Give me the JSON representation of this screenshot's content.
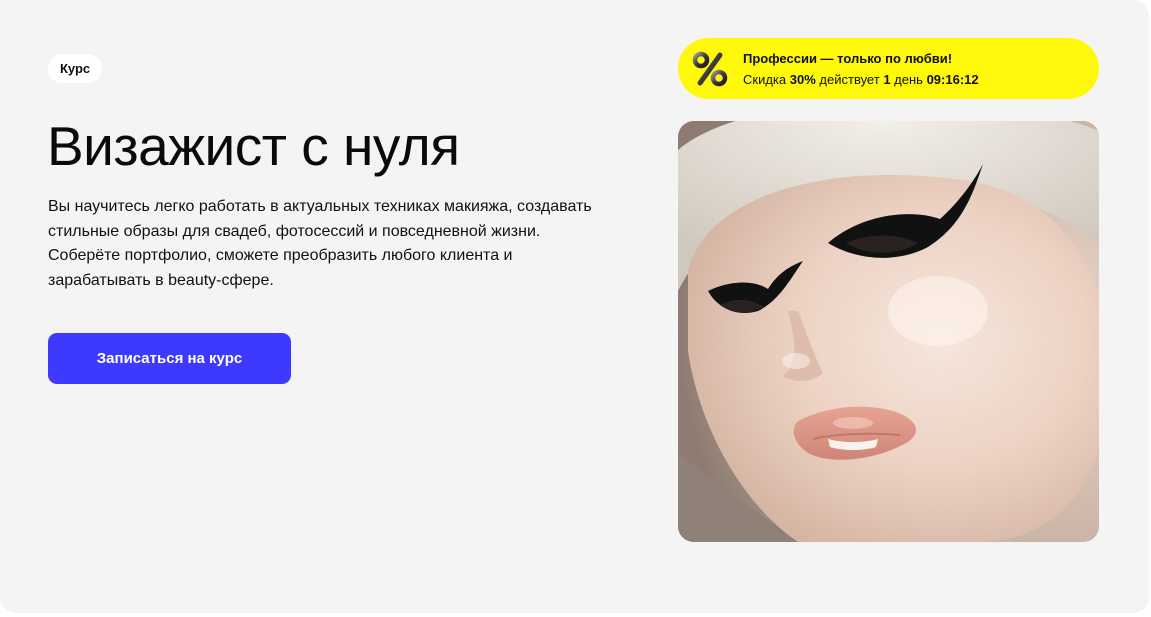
{
  "hero": {
    "badge": "Курс",
    "title": "Визажист с нуля",
    "description": "Вы научитесь легко работать в актуальных техниках макияжа, создавать стильные образы для свадеб, фотосессий и повседневной жизни. Соберёте портфолио, сможете преобразить любого клиента и зарабатывать в beauty-сфере.",
    "cta_label": "Записаться на курс"
  },
  "promo": {
    "icon": "percent-icon",
    "headline": "Профессии — только по любви!",
    "discount_prefix": "Скидка",
    "discount_value": "30%",
    "discount_middle": "действует",
    "days_value": "1",
    "days_word": "день",
    "timer": "09:16:12"
  },
  "colors": {
    "background": "#f4f4f4",
    "cta": "#3d39fe",
    "promo": "#fff80a"
  }
}
